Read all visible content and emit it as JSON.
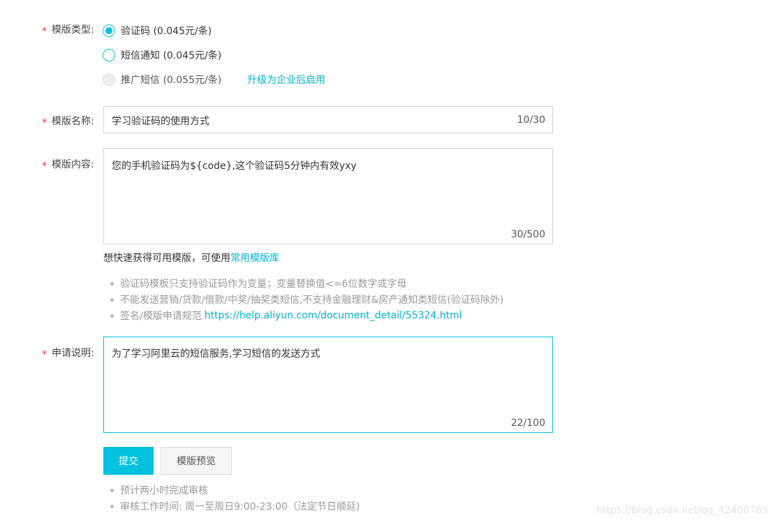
{
  "template_type": {
    "label": "模版类型:",
    "options": [
      {
        "label": "验证码 (0.045元/条)",
        "state": "selected"
      },
      {
        "label": "短信通知 (0.045元/条)",
        "state": "unselected"
      },
      {
        "label": "推广短信 (0.055元/条)",
        "state": "disabled"
      }
    ],
    "upgrade_link": "升级为企业后启用"
  },
  "template_name": {
    "label": "模版名称:",
    "value": "学习验证码的使用方式",
    "counter": "10/30"
  },
  "template_content": {
    "label": "模版内容:",
    "value": "您的手机验证码为${code},这个验证码5分钟内有效yxy",
    "counter": "30/500",
    "quick_tip": "想快速获得可用模版，可使用",
    "library_link": "常用模版库",
    "tips": [
      "验证码模板只支持验证码作为变量；变量替换值<=6位数字或字母",
      "不能发送营销/贷款/借款/中奖/抽奖类短信,不支持金融理财&房产通知类短信(验证码除外)"
    ],
    "spec_tip": "签名/模版申请规范",
    "spec_link": "https://help.aliyun.com/document_detail/55324.html"
  },
  "application_note": {
    "label": "申请说明:",
    "value": "为了学习阿里云的短信服务,学习短信的发送方式",
    "counter": "22/100"
  },
  "actions": {
    "submit": "提交",
    "preview": "模版预览"
  },
  "footer_tips": [
    "预计两小时完成审核",
    "审核工作时间: 周一至周日9:00-23:00（法定节日顺延)"
  ],
  "watermark": "https://blog.csdn.net/qq_42400763",
  "required_mark": "*",
  "colors": {
    "accent": "#00c1de",
    "link": "#00b3cc",
    "required": "#e4393c"
  }
}
